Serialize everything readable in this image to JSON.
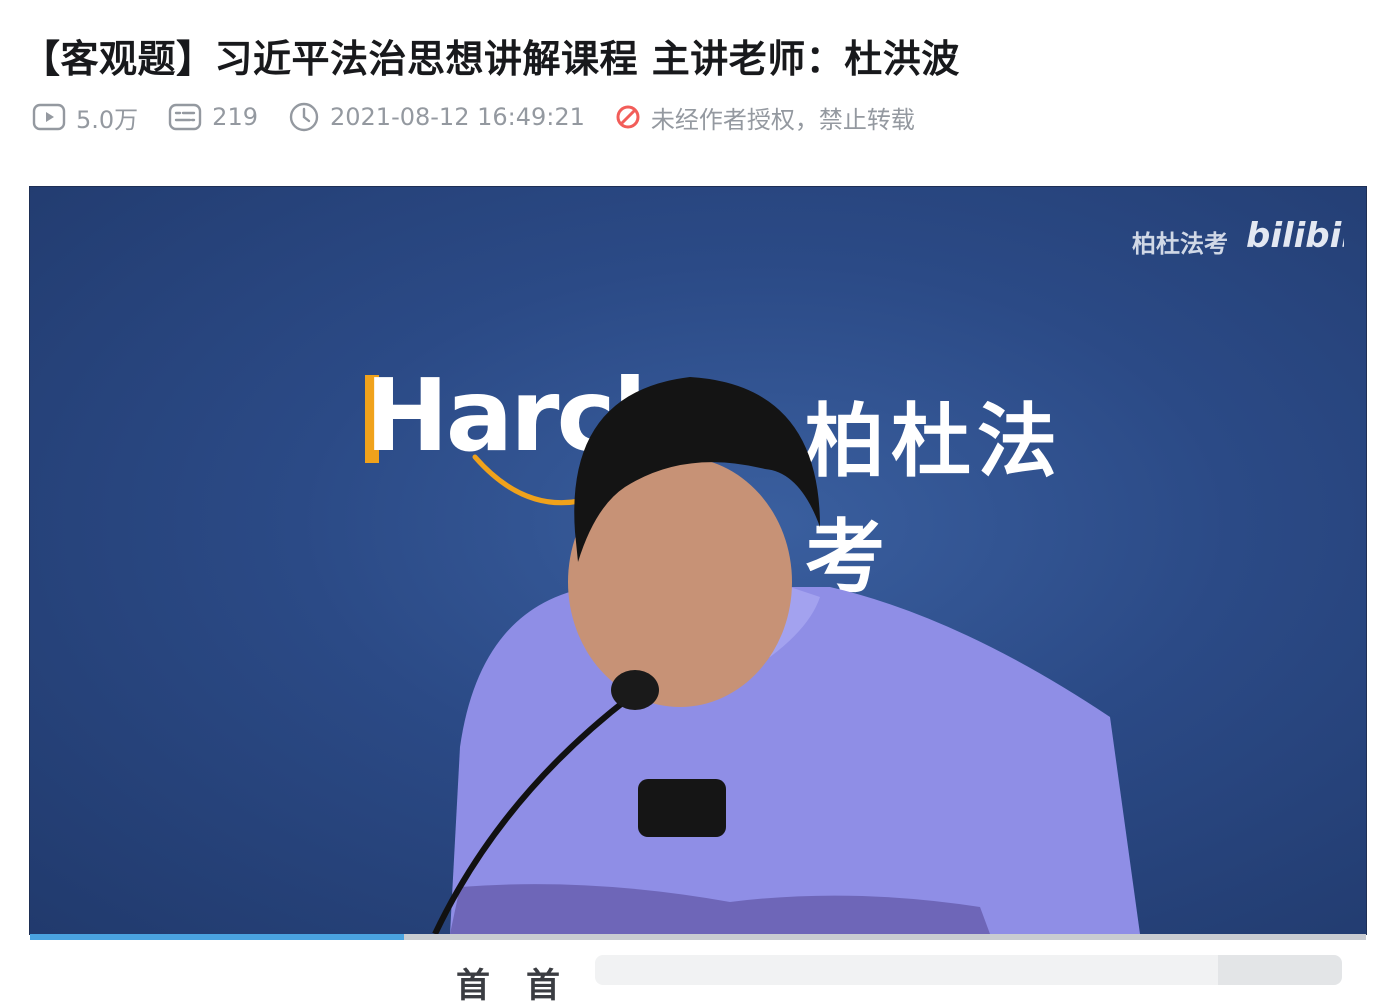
{
  "video": {
    "title": "【客观题】习近平法治思想讲解课程 主讲老师：杜洪波",
    "stats": {
      "views": "5.0万",
      "danmaku": "219",
      "publish_time": "2021-08-12 16:49:21",
      "copyright_notice": "未经作者授权，禁止转载"
    },
    "icons": {
      "views": "play-count-icon",
      "danmaku": "danmaku-icon",
      "time": "clock-icon",
      "copyright": "no-reprint-icon"
    }
  },
  "player": {
    "watermark_text": "柏杜法考",
    "watermark_logo": "bilibili",
    "brand_en": "Harch",
    "brand_cn": "柏杜法考",
    "progress": 0.28
  },
  "colors": {
    "title": "#18191c",
    "meta": "#9499a0",
    "no_reprint": "#f25d59",
    "brand_accent": "#f0a21b",
    "player_bg": "#29467f",
    "progress": "#4aa3e0"
  }
}
